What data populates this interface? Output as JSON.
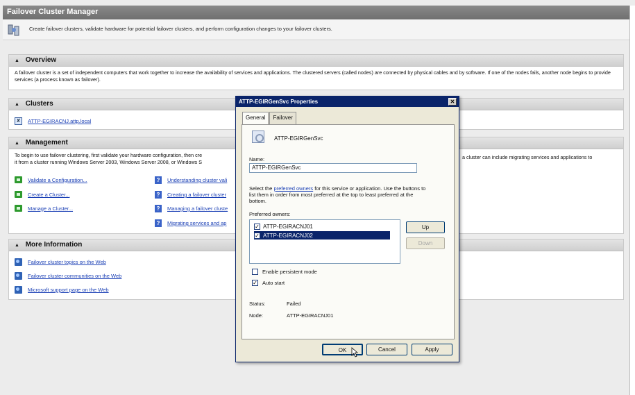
{
  "window": {
    "title": "Failover Cluster Manager"
  },
  "banner": {
    "text": "Create failover clusters, validate hardware for potential failover clusters, and perform configuration changes to your failover clusters."
  },
  "overview": {
    "title": "Overview",
    "text": "A failover cluster is a set of independent computers that work together to increase the availability of services and applications. The clustered servers (called nodes) are connected by physical cables and by software. If one of the nodes fails, another node begins to provide services (a process known as failover)."
  },
  "clusters": {
    "title": "Clusters",
    "items": [
      {
        "label": "ATTP-EGIRACNJ.attp.local"
      }
    ]
  },
  "management": {
    "title": "Management",
    "text_left": "To begin to use failover clustering, first validate your hardware configuration, then cre",
    "text_left2": "it from a cluster running Windows Server 2003, Windows Server 2008, or Windows S",
    "text_right": "a cluster can include migrating services and applications to",
    "actions": [
      "Validate a Configuration...",
      "Create a Cluster...",
      "Manage a Cluster..."
    ],
    "help_links": [
      "Understanding cluster vali",
      "Creating a failover cluster",
      "Managing a failover cluste",
      "Migrating services and ap"
    ]
  },
  "more_info": {
    "title": "More Information",
    "links": [
      "Failover cluster topics on the Web",
      "Failover cluster communities on the Web",
      "Microsoft support page on the Web"
    ]
  },
  "dialog": {
    "title": "ATTP-EGIRGenSvc Properties",
    "tabs": [
      "General",
      "Failover"
    ],
    "service_name": "ATTP-EGIRGenSvc",
    "name_label": "Name:",
    "name_value": "ATTP-EGIRGenSvc",
    "desc_prefix": "Select the ",
    "desc_link": "preferred owners",
    "desc_suffix": " for this service or application. Use the buttons to list them in order from most preferred at the top to least preferred at the bottom.",
    "preferred_label": "Preferred owners:",
    "owners": [
      {
        "name": "ATTP-EGIRACNJ01",
        "checked": true,
        "selected": false
      },
      {
        "name": "ATTP-EGIRACNJ02",
        "checked": true,
        "selected": true
      }
    ],
    "up_label": "Up",
    "down_label": "Down",
    "persistent_label": "Enable persistent mode",
    "persistent_checked": false,
    "autostart_label": "Auto start",
    "autostart_checked": true,
    "status_label": "Status:",
    "status_value": "Failed",
    "node_label": "Node:",
    "node_value": "ATTP-EGIRACNJ01",
    "ok_label": "OK",
    "cancel_label": "Cancel",
    "apply_label": "Apply"
  }
}
